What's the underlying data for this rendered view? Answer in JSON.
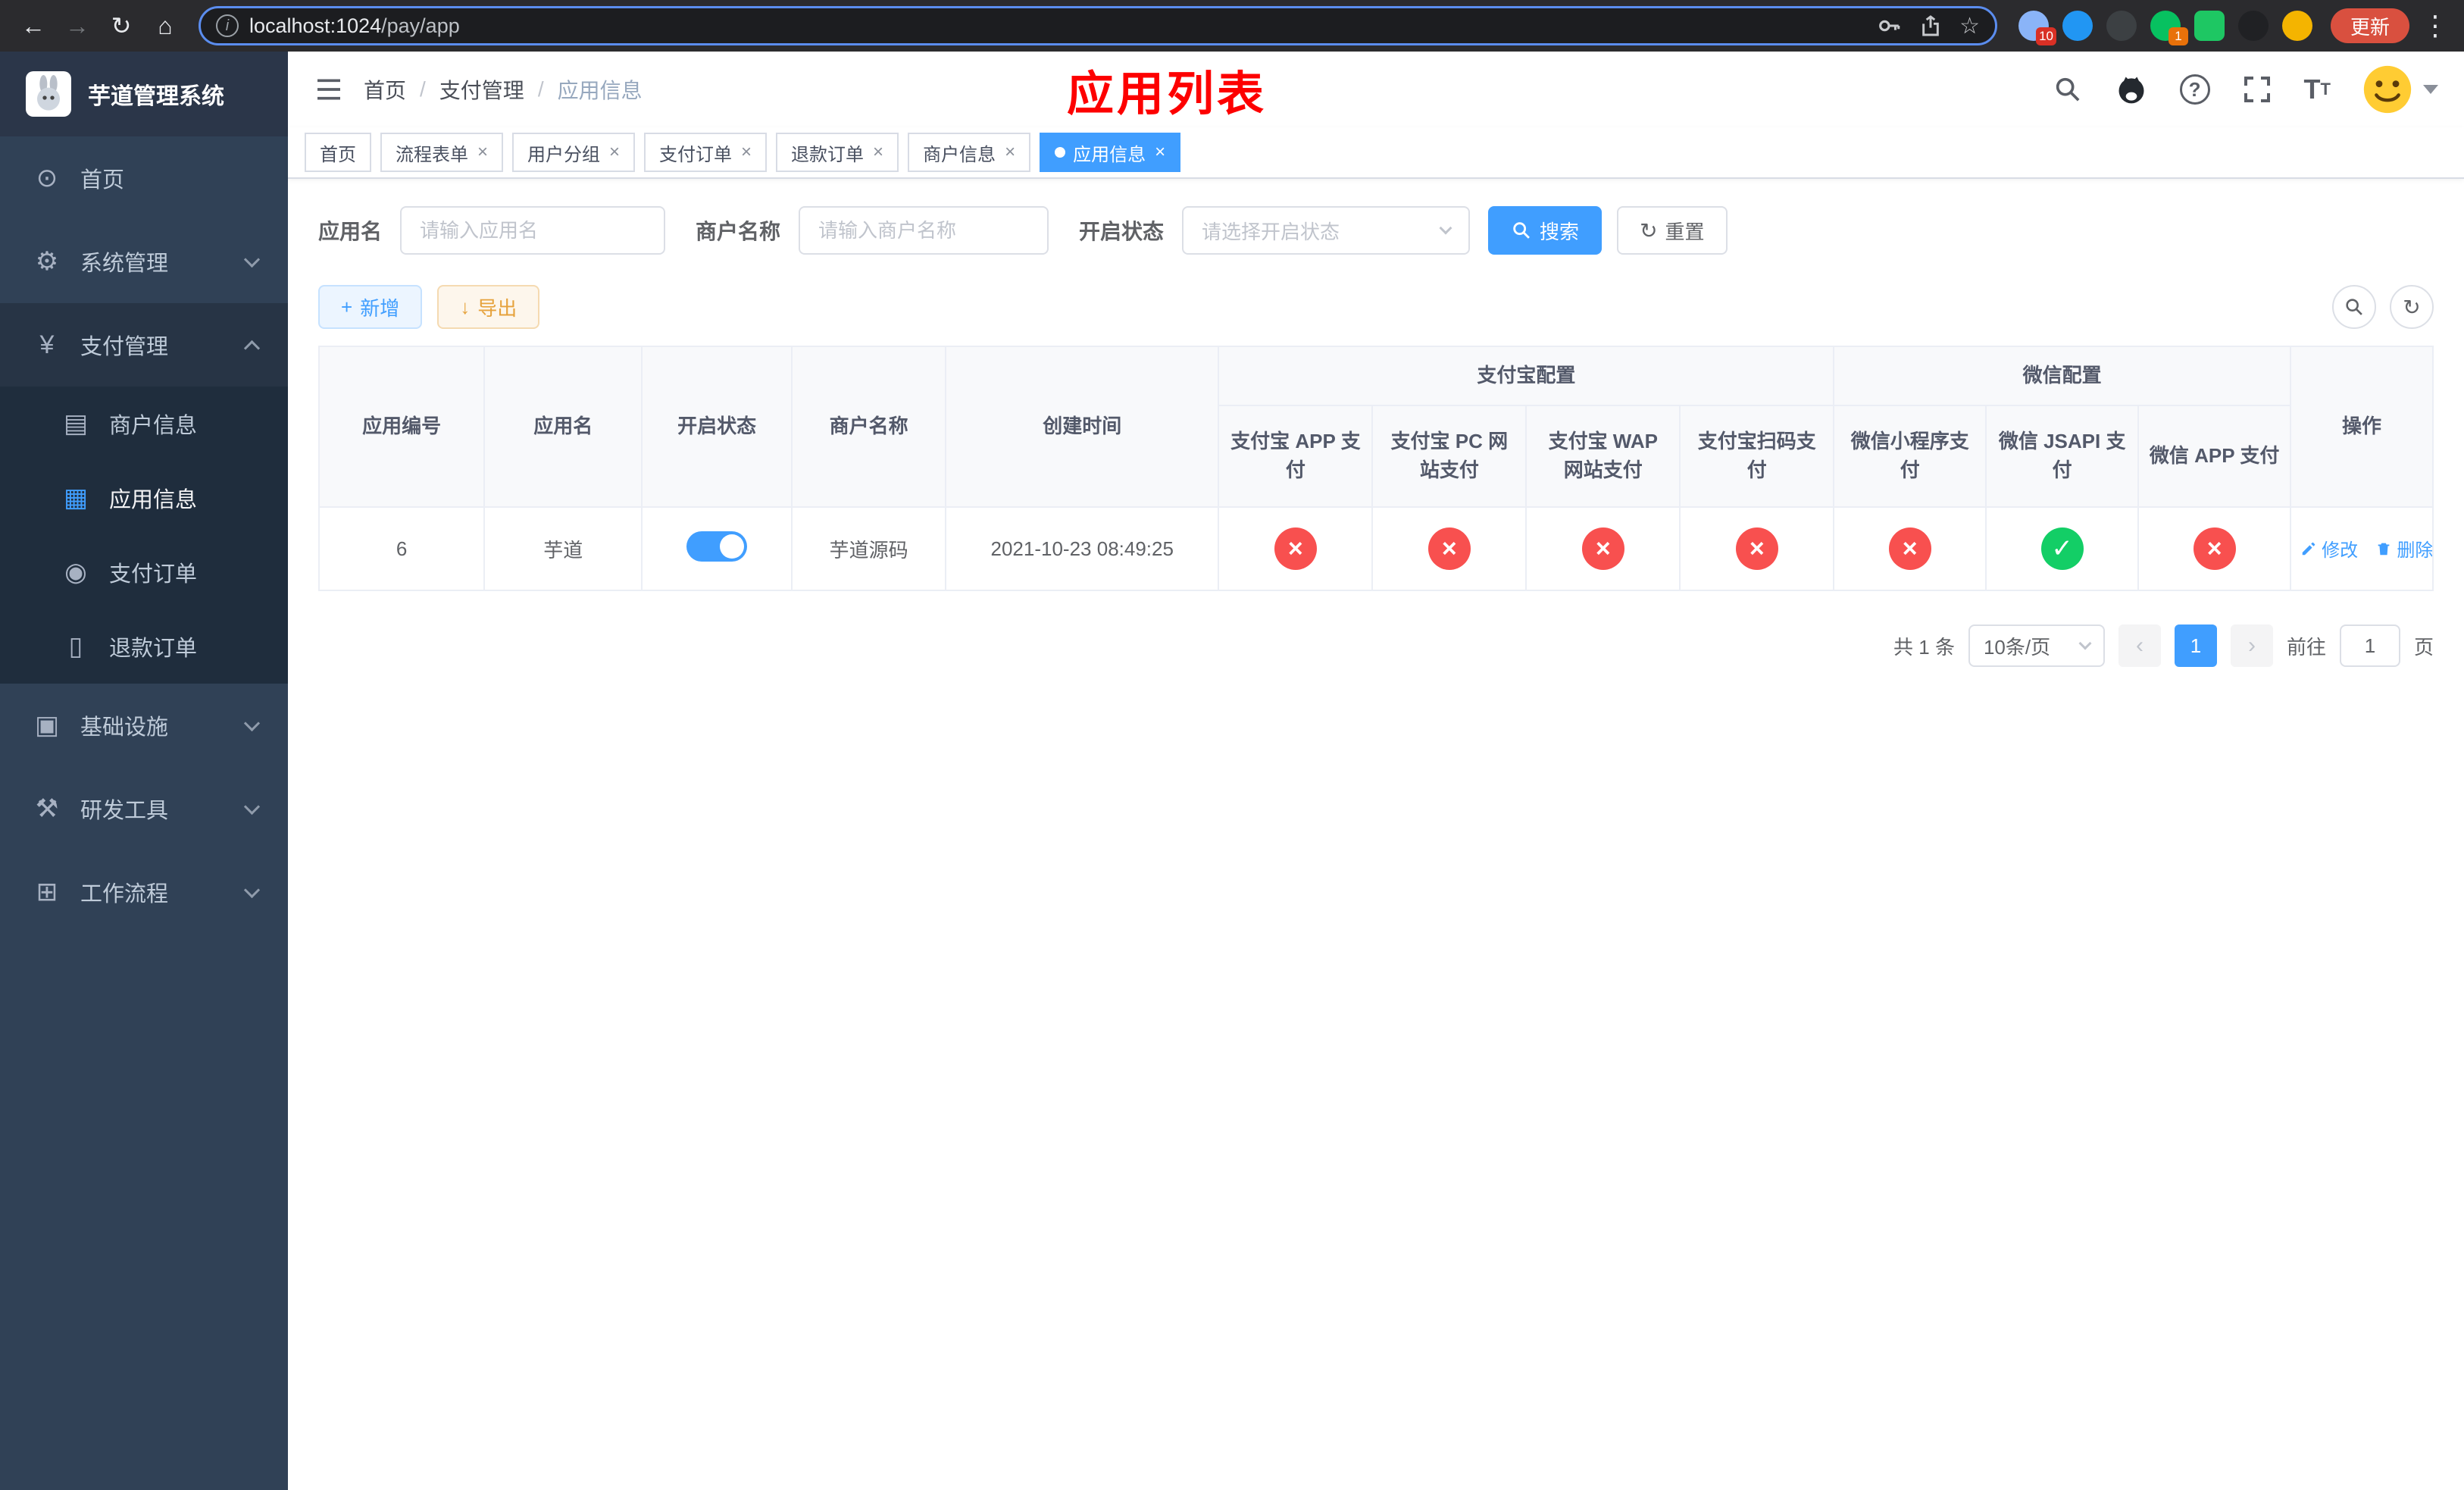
{
  "colors": {
    "accent": "#409eff",
    "success": "#13ce66",
    "danger": "#f8504f",
    "warning": "#e6a23c",
    "sidebar_bg": "#304156",
    "submenu_bg": "#1f2d3d"
  },
  "icons": {
    "back": "←",
    "forward": "→",
    "reload": "↻",
    "home": "⌂",
    "info": "i",
    "star": "☆",
    "kebab": "⋮",
    "menu_home": "⊙",
    "menu_system": "⚙",
    "menu_pay": "¥",
    "menu_merchant": "▤",
    "menu_app": "▦",
    "menu_pay_order": "◉",
    "menu_refund": "▯",
    "menu_infra": "▣",
    "menu_devtools": "⚒",
    "menu_workflow": "⊞",
    "question": "?",
    "font_big": "T",
    "font_small": "T",
    "plus": "+",
    "download": "↓",
    "refresh": "↻",
    "success": "✓",
    "fail": "×",
    "prev": "‹",
    "next": "›"
  },
  "browser": {
    "url_host": "localhost:1024",
    "url_path": "/pay/app",
    "update_label": "更新",
    "badge_red": "10",
    "badge_orange": "1"
  },
  "sidebar": {
    "app_title": "芋道管理系统",
    "home": "首页",
    "system": "系统管理",
    "pay": "支付管理",
    "merchant": "商户信息",
    "app_info": "应用信息",
    "pay_order": "支付订单",
    "refund_order": "退款订单",
    "infra": "基础设施",
    "dev_tools": "研发工具",
    "workflow": "工作流程"
  },
  "header": {
    "breadcrumb": [
      "首页",
      "支付管理",
      "应用信息"
    ],
    "annotation": "应用列表"
  },
  "tabs": [
    {
      "label": "首页",
      "closable": false,
      "active": false
    },
    {
      "label": "流程表单",
      "closable": true,
      "active": false
    },
    {
      "label": "用户分组",
      "closable": true,
      "active": false
    },
    {
      "label": "支付订单",
      "closable": true,
      "active": false
    },
    {
      "label": "退款订单",
      "closable": true,
      "active": false
    },
    {
      "label": "商户信息",
      "closable": true,
      "active": false
    },
    {
      "label": "应用信息",
      "closable": true,
      "active": true
    }
  ],
  "filter": {
    "app_name_label": "应用名",
    "app_name_placeholder": "请输入应用名",
    "merchant_label": "商户名称",
    "merchant_placeholder": "请输入商户名称",
    "status_label": "开启状态",
    "status_placeholder": "请选择开启状态",
    "search": "搜索",
    "reset": "重置"
  },
  "toolbar": {
    "add": "新增",
    "export": "导出"
  },
  "table": {
    "col_app_id": "应用编号",
    "col_app_name": "应用名",
    "col_status": "开启状态",
    "col_merchant": "商户名称",
    "col_created": "创建时间",
    "group_alipay": "支付宝配置",
    "group_wechat": "微信配置",
    "col_alipay_app": "支付宝 APP 支付",
    "col_alipay_pc": "支付宝 PC 网站支付",
    "col_alipay_wap": "支付宝 WAP 网站支付",
    "col_alipay_qr": "支付宝扫码支付",
    "col_wx_mini": "微信小程序支付",
    "col_wx_jsapi": "微信 JSAPI 支付",
    "col_wx_app": "微信 APP 支付",
    "col_ops": "操作",
    "row": {
      "id": "6",
      "name": "芋道",
      "status_on": true,
      "merchant": "芋道源码",
      "created": "2021-10-23 08:49:25",
      "configs": [
        false,
        false,
        false,
        false,
        false,
        true,
        false
      ],
      "edit": "修改",
      "delete": "删除"
    }
  },
  "pagination": {
    "total": "共 1 条",
    "page_size": "10条/页",
    "page": "1",
    "goto": "前往",
    "goto_value": "1",
    "unit": "页"
  }
}
